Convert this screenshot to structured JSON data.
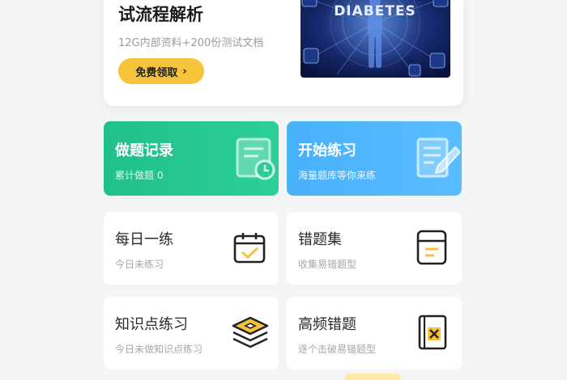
{
  "banner": {
    "title": "试流程解析",
    "subtitle": "12G内部资料+200份测试文档",
    "button_label": "免费领取",
    "button_arrow": "›",
    "image_text": "DIABETES",
    "image_icon": "diabetes-illustration"
  },
  "cards": {
    "record": {
      "title": "做题记录",
      "subtitle": "累计做题 0",
      "icon": "record-clock-icon",
      "color": "#22c28c"
    },
    "practice": {
      "title": "开始练习",
      "subtitle": "海量题库等你来练",
      "icon": "pencil-doc-icon",
      "color": "#4ab3fb"
    },
    "daily": {
      "title": "每日一练",
      "subtitle": "今日未练习",
      "icon": "calendar-check-icon"
    },
    "wrong_set": {
      "title": "错题集",
      "subtitle": "收集易错题型",
      "icon": "book-icon"
    },
    "knowledge": {
      "title": "知识点练习",
      "subtitle": "今日未做知识点练习",
      "icon": "layers-icon"
    },
    "frequent_wrong": {
      "title": "高频错题",
      "subtitle": "逐个击破易错题型",
      "icon": "book-x-icon"
    }
  },
  "colors": {
    "accent_yellow": "#f6c33a",
    "icon_dark": "#222222"
  }
}
